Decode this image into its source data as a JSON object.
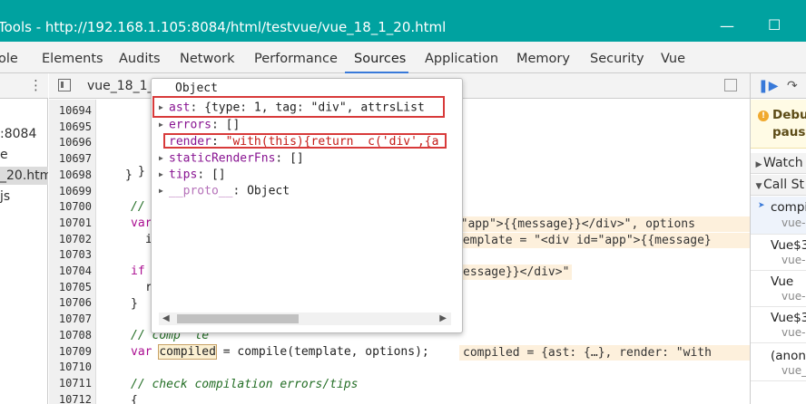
{
  "window": {
    "title": "Tools - http://192.168.1.105:8084/html/testvue/vue_18_1_20.html",
    "controls": [
      "minimize-icon",
      "maximize-icon"
    ]
  },
  "tabs": [
    "ole",
    "Elements",
    "Audits",
    "Network",
    "Performance",
    "Sources",
    "Application",
    "Memory",
    "Security",
    "Vue"
  ],
  "active_tab": "Sources",
  "navigator": {
    "items": [
      ":8084",
      "e",
      "_20.html",
      "js"
    ],
    "selected_index": 2
  },
  "editor": {
    "file_tab": "vue_18_1_",
    "line_numbers": [
      "10694",
      "10695",
      "10696",
      "10697",
      "10698",
      "10699",
      "10700",
      "10701",
      "10702",
      "10703",
      "10704",
      "10705",
      "10706",
      "10707",
      "10708",
      "10709",
      "10710",
      "10711",
      "10712"
    ],
    "inline_values": {
      "line_10701": "d=\"app\">{{message}}</div>\", options",
      "line_10702": "template = \"<div id=\"app\">{{message}",
      "line_10704": "essage}}</div>\"",
      "line_10709": "compiled = {ast: {…}, render: \"with"
    },
    "code": {
      "line_10698": "}",
      "line_10699": "}",
      "line_10700": "//",
      "line_10701": "var",
      "line_10702": "i",
      "line_10704": "if",
      "line_10705": "r",
      "line_10706": "}",
      "line_10708": "// comp  le",
      "line_10709_kw": "var ",
      "line_10709_var": "compiled",
      "line_10709_rest": " = compile(template, options);",
      "line_10711": "// check compilation errors/tips",
      "line_10712": "{"
    }
  },
  "popover": {
    "title": "Object",
    "properties": [
      {
        "key": "ast",
        "value": "{type: 1, tag: \"div\", attrsList",
        "expandable": true,
        "string_part": "\"div\""
      },
      {
        "key": "errors",
        "value": "[]",
        "expandable": true
      },
      {
        "key": "render",
        "value": "\"with(this){return _c('div',{a",
        "expandable": false
      },
      {
        "key": "staticRenderFns",
        "value": "[]",
        "expandable": true
      },
      {
        "key": "tips",
        "value": "[]",
        "expandable": true
      },
      {
        "key": "__proto__",
        "value": "Object",
        "expandable": true
      }
    ],
    "colors": {
      "key": "#881391",
      "string": "#c41a16",
      "highlight_box": "#d83a3a"
    }
  },
  "debugger": {
    "paused_text_line1": "Debu",
    "paused_text_line2": "pause",
    "sections": [
      {
        "label": "Watch",
        "expanded": false
      },
      {
        "label": "Call St",
        "expanded": true
      }
    ],
    "call_stack": [
      {
        "fn": "compi",
        "loc": "vue-",
        "current": true
      },
      {
        "fn": "Vue$3",
        "loc": "vue-"
      },
      {
        "fn": "Vue",
        "loc": "vue-"
      },
      {
        "fn": "Vue$3",
        "loc": "vue-"
      },
      {
        "fn": "(anon",
        "loc": "vue_"
      }
    ]
  },
  "colors": {
    "title_bar": "#00a2a0",
    "tab_underline": "#3879d9",
    "inline_value_bg": "#fdf0dc",
    "paused_bg": "#fffbe5"
  }
}
